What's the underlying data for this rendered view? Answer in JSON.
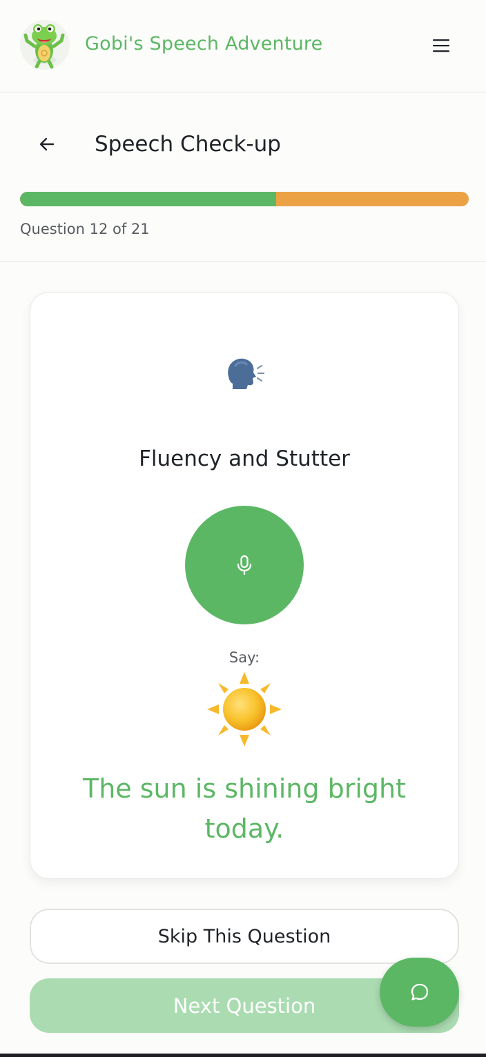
{
  "header": {
    "app_title": "Gobi's Speech Adventure",
    "logo_icon": "frog-mascot-icon",
    "menu_icon": "hamburger-menu-icon"
  },
  "subheader": {
    "back_icon": "arrow-left-icon",
    "page_title": "Speech Check-up",
    "progress": {
      "current": 12,
      "total": 21,
      "fraction": 0.571,
      "text": "Question 12 of 21",
      "filled_color": "#5cb765",
      "remaining_color": "#eba244"
    }
  },
  "card": {
    "category_icon": "speaking-head-icon",
    "category": "Fluency and Stutter",
    "mic_icon": "microphone-icon",
    "say_label": "Say:",
    "picture_icon": "sun-icon",
    "prompt": "The sun is shining bright today."
  },
  "actions": {
    "skip_label": "Skip This Question",
    "next_label": "Next Question",
    "chat_icon": "chat-bubble-icon"
  },
  "colors": {
    "accent": "#5cb765",
    "accent_disabled": "#abdbb1",
    "progress_remaining": "#eba244",
    "background": "#fcfcfa"
  }
}
